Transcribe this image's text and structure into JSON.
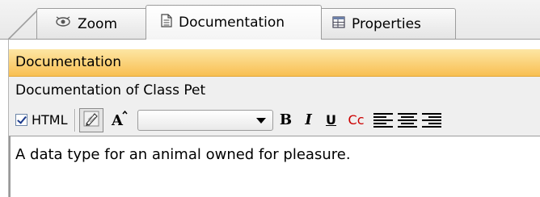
{
  "tabs": [
    {
      "label": "Zoom",
      "icon": "zoom-icon"
    },
    {
      "label": "Documentation",
      "icon": "document-icon",
      "active": true
    },
    {
      "label": "Properties",
      "icon": "properties-icon"
    }
  ],
  "panel": {
    "header": "Documentation",
    "subtitle": "Documentation of Class Pet"
  },
  "toolbar": {
    "html_label": "HTML",
    "html_checked": true,
    "font_select_value": "",
    "bold": "B",
    "italic": "I",
    "underline": "U",
    "color": "Cc"
  },
  "editor": {
    "text": "A data type for an animal owned for pleasure."
  },
  "colors": {
    "header_top": "#fde6a4",
    "header_bottom": "#f8bf52",
    "color_button_red": "#cc0000"
  }
}
